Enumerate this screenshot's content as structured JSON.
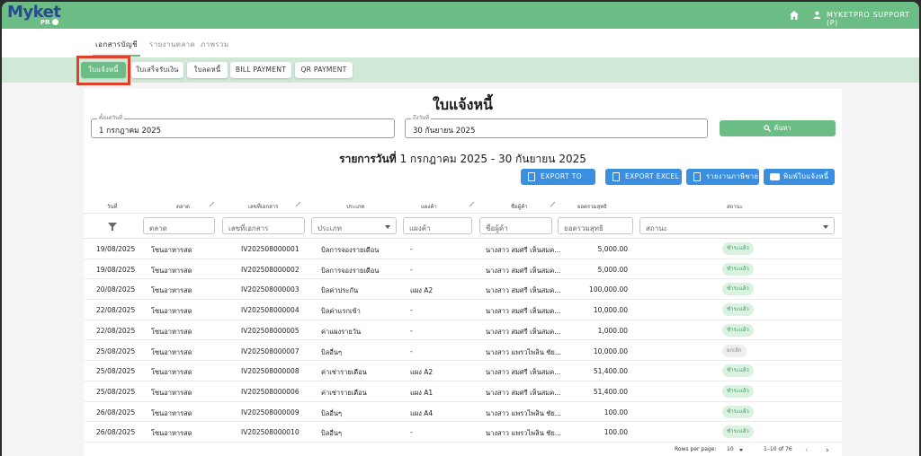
{
  "app": {
    "logo": "Myket",
    "logo_sub": "PR",
    "user": "MYKETPRO SUPPORT (P)"
  },
  "tabs": [
    {
      "label": "เอกสารบัญชี",
      "active": true
    },
    {
      "label": "รายงานตลาด",
      "active": false
    },
    {
      "label": "ภาพรวม",
      "active": false
    }
  ],
  "doc_types": [
    {
      "label": "ใบแจ้งหนี้",
      "active": true
    },
    {
      "label": "ใบเสร็จรับเงิน",
      "active": false
    },
    {
      "label": "ใบลดหนี้",
      "active": false
    },
    {
      "label": "BILL PAYMENT",
      "active": false
    },
    {
      "label": "QR PAYMENT",
      "active": false
    }
  ],
  "page_title": "ใบแจ้งหนี้",
  "date_from": {
    "label": "ตั้งแต่วันที่",
    "value": "1 กรกฎาคม 2025"
  },
  "date_to": {
    "label": "ถึงวันที่",
    "value": "30 กันยายน 2025"
  },
  "search_label": "ค้นหา",
  "range": {
    "prefix": "รายการวันที่",
    "text": " 1 กรกฎาคม 2025 - 30 กันยายน 2025"
  },
  "actions": [
    "EXPORT TO ERP",
    "EXPORT EXCEL",
    "รายงานภาษีขาย",
    "พิมพ์ใบแจ้งหนี้"
  ],
  "columns": [
    "วันที่",
    "ตลาด",
    "เลขที่เอกสาร",
    "ประเภท",
    "แผงค้า",
    "ชื่อผู้ค้า",
    "ยอดรวมสุทธิ",
    "สถานะ"
  ],
  "filters": {
    "market": "ตลาด",
    "doc_no": "เลขที่เอกสาร",
    "type": "ประเภท",
    "stall": "แผงค้า",
    "vendor": "ชื่อผู้ค้า",
    "total": "ยอดรวมสุทธิ",
    "status": "สถานะ"
  },
  "rows": [
    {
      "date": "19/08/2025",
      "market": "โซนอาหารสด",
      "doc_no": "IV202508000001",
      "type": "บิลการจองรายเดือน",
      "stall": "-",
      "vendor": "นางสาว สมศรี เห็นสมค...",
      "total": "5,000.00",
      "status": "ชำระแล้ว"
    },
    {
      "date": "19/08/2025",
      "market": "โซนอาหารสด",
      "doc_no": "IV202508000002",
      "type": "บิลการจองรายเดือน",
      "stall": "-",
      "vendor": "นางสาว สมศรี เห็นสมค...",
      "total": "5,000.00",
      "status": "ชำระแล้ว"
    },
    {
      "date": "20/08/2025",
      "market": "โซนอาหารสด",
      "doc_no": "IV202508000003",
      "type": "บิลค่าประกัน",
      "stall": "แผง A2",
      "vendor": "นางสาว สมศรี เห็นสมค...",
      "total": "100,000.00",
      "status": "ชำระแล้ว"
    },
    {
      "date": "22/08/2025",
      "market": "โซนอาหารสด",
      "doc_no": "IV202508000004",
      "type": "บิลค่าแรกเข้า",
      "stall": "-",
      "vendor": "นางสาว สมศรี เห็นสมค...",
      "total": "10,000.00",
      "status": "ชำระแล้ว"
    },
    {
      "date": "22/08/2025",
      "market": "โซนอาหารสด",
      "doc_no": "IV202508000005",
      "type": "ค่าแผงรายวัน",
      "stall": "-",
      "vendor": "นางสาว สมศรี เห็นสมค...",
      "total": "1,000.00",
      "status": "ชำระแล้ว"
    },
    {
      "date": "25/08/2025",
      "market": "โซนอาหารสด",
      "doc_no": "IV202508000007",
      "type": "บิลอื่นๆ",
      "stall": "-",
      "vendor": "นางสาว แพรวไพลิน ชัย...",
      "total": "10,000.00",
      "status": "ยกเลิก"
    },
    {
      "date": "25/08/2025",
      "market": "โซนอาหารสด",
      "doc_no": "IV202508000008",
      "type": "ค่าเช่ารายเดือน",
      "stall": "แผง A2",
      "vendor": "นางสาว สมศรี เห็นสมค...",
      "total": "51,400.00",
      "status": "ชำระแล้ว"
    },
    {
      "date": "25/08/2025",
      "market": "โซนอาหารสด",
      "doc_no": "IV202508000006",
      "type": "ค่าเช่ารายเดือน",
      "stall": "แผง A1",
      "vendor": "นางสาว สมศรี เห็นสมค...",
      "total": "51,400.00",
      "status": "ชำระแล้ว"
    },
    {
      "date": "26/08/2025",
      "market": "โซนอาหารสด",
      "doc_no": "IV202508000009",
      "type": "บิลอื่นๆ",
      "stall": "แผง A4",
      "vendor": "นางสาว แพรวไพลิน ชัย...",
      "total": "100.00",
      "status": "ชำระแล้ว"
    },
    {
      "date": "26/08/2025",
      "market": "โซนอาหารสด",
      "doc_no": "IV202508000010",
      "type": "บิลอื่นๆ",
      "stall": "-",
      "vendor": "นางสาว แพรวไพลิน ชัย...",
      "total": "100.00",
      "status": "ชำระแล้ว"
    }
  ],
  "pagination": {
    "rows_per_page_label": "Rows per page:",
    "rows_per_page": "10",
    "range": "1–10 of 76"
  },
  "colors": {
    "primary": "#6cbd85",
    "action": "#3a8fe0",
    "highlight": "#e0402a"
  }
}
